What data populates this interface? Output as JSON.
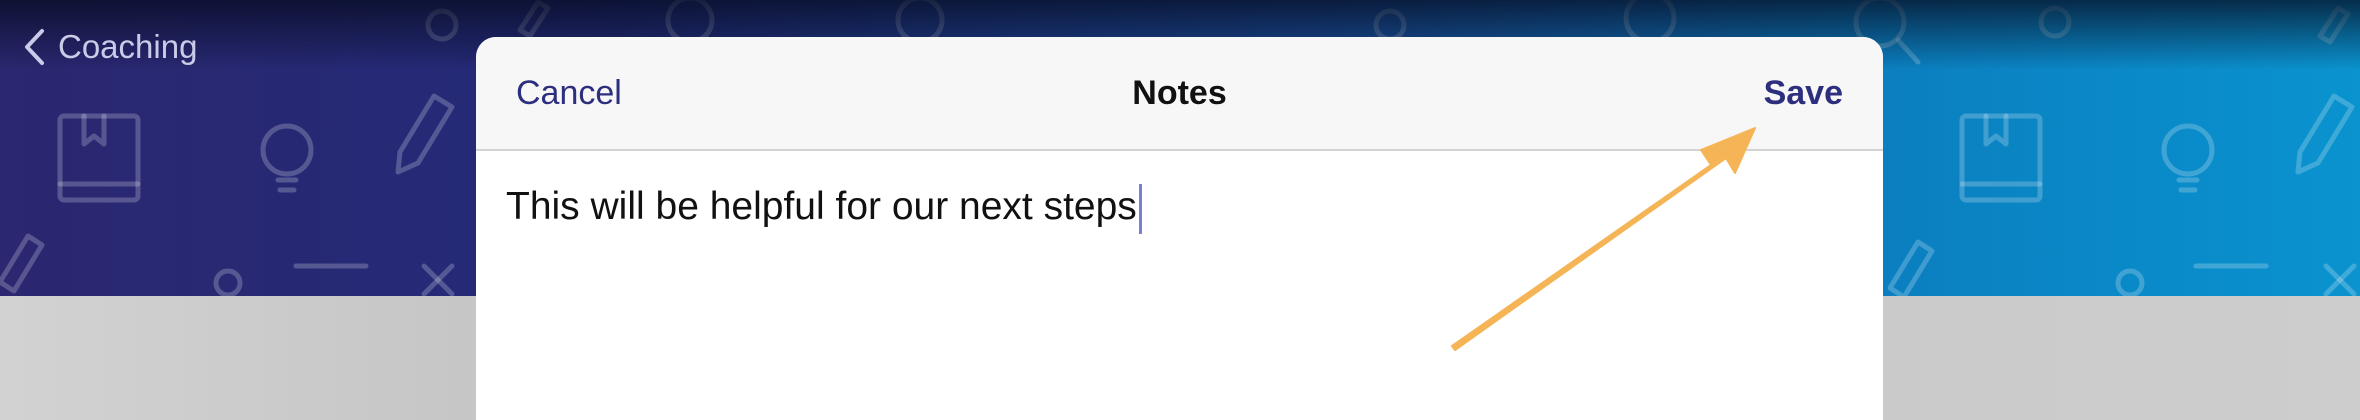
{
  "nav": {
    "back_label": "Coaching",
    "back_icon": "chevron-left-icon"
  },
  "modal": {
    "title": "Notes",
    "cancel_label": "Cancel",
    "save_label": "Save",
    "notes_text": "This will be helpful for our next steps"
  },
  "colors": {
    "header_gradient_start": "#2b2770",
    "header_gradient_end": "#0a93cf",
    "button_text": "#2d2f7e",
    "annotation_arrow": "#f5b556"
  }
}
